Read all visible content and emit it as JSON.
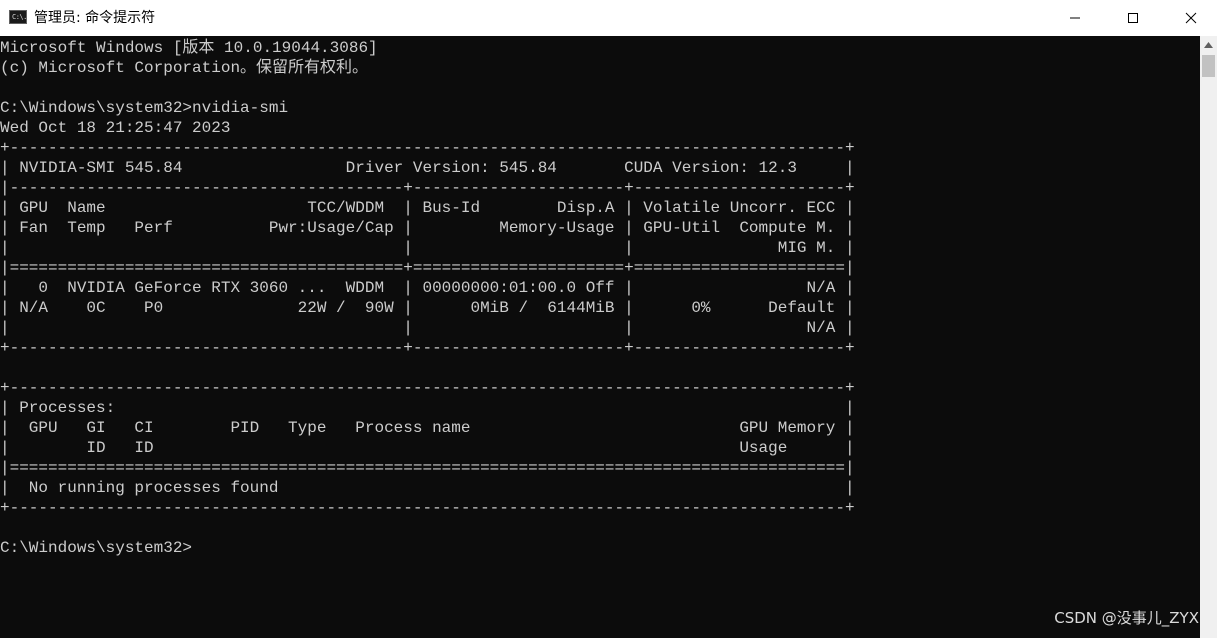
{
  "window": {
    "title": "管理员: 命令提示符",
    "icon": "cmd-icon",
    "icon_text": "C:\\.",
    "controls": [
      "minimize-icon",
      "maximize-icon",
      "close-icon"
    ]
  },
  "console": {
    "lines": [
      "Microsoft Windows [版本 10.0.19044.3086]",
      "(c) Microsoft Corporation。保留所有权利。",
      "",
      "C:\\Windows\\system32>nvidia-smi",
      "Wed Oct 18 21:25:47 2023",
      "+---------------------------------------------------------------------------------------+",
      "| NVIDIA-SMI 545.84                 Driver Version: 545.84       CUDA Version: 12.3     |",
      "|-----------------------------------------+----------------------+----------------------+",
      "| GPU  Name                     TCC/WDDM  | Bus-Id        Disp.A | Volatile Uncorr. ECC |",
      "| Fan  Temp   Perf          Pwr:Usage/Cap |         Memory-Usage | GPU-Util  Compute M. |",
      "|                                         |                      |               MIG M. |",
      "|=========================================+======================+======================|",
      "|   0  NVIDIA GeForce RTX 3060 ...  WDDM  | 00000000:01:00.0 Off |                  N/A |",
      "| N/A    0C    P0              22W /  90W |      0MiB /  6144MiB |      0%      Default |",
      "|                                         |                      |                  N/A |",
      "+-----------------------------------------+----------------------+----------------------+",
      "",
      "+---------------------------------------------------------------------------------------+",
      "| Processes:                                                                            |",
      "|  GPU   GI   CI        PID   Type   Process name                            GPU Memory |",
      "|        ID   ID                                                             Usage      |",
      "|=======================================================================================|",
      "|  No running processes found                                                           |",
      "+---------------------------------------------------------------------------------------+",
      "",
      "C:\\Windows\\system32>"
    ]
  },
  "watermark": "CSDN @没事儿_ZYX",
  "colors": {
    "console_bg": "#0c0c0c",
    "console_text": "#cccccc",
    "titlebar_bg": "#ffffff",
    "scrollbar_bg": "#f0f0f0",
    "scrollbar_thumb": "#c2c2c2"
  }
}
